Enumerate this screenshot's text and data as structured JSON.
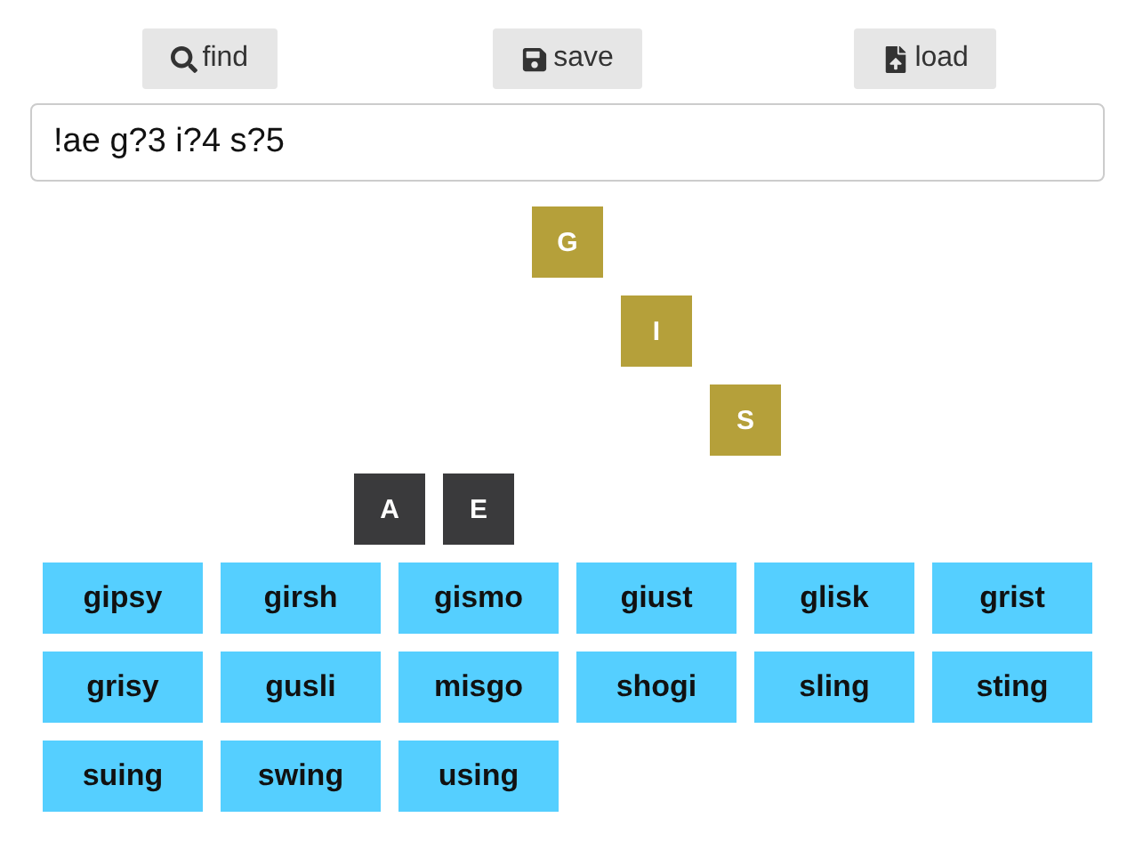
{
  "toolbar": [
    {
      "kind": "find",
      "label": "find"
    },
    {
      "kind": "save",
      "label": "save"
    },
    {
      "kind": "load",
      "label": "load"
    }
  ],
  "query": {
    "value": "!ae g?3 i?4 s?5"
  },
  "board": [
    [
      {
        "kind": "blank"
      },
      {
        "kind": "blank"
      },
      {
        "kind": "tile",
        "letter": "G",
        "color": "#b5a03a"
      }
    ],
    [
      {
        "kind": "blank"
      },
      {
        "kind": "blank"
      },
      {
        "kind": "blank"
      },
      {
        "kind": "tile",
        "letter": "I",
        "color": "#b5a03a"
      }
    ],
    [
      {
        "kind": "blank"
      },
      {
        "kind": "blank"
      },
      {
        "kind": "blank"
      },
      {
        "kind": "blank"
      },
      {
        "kind": "tile",
        "letter": "S",
        "color": "#b5a03a"
      }
    ],
    [
      {
        "kind": "tile",
        "letter": "A",
        "color": "#3a3a3c"
      },
      {
        "kind": "tile",
        "letter": "E",
        "color": "#3a3a3c"
      }
    ]
  ],
  "words": [
    "gipsy",
    "girsh",
    "gismo",
    "giust",
    "glisk",
    "grist",
    "grisy",
    "gusli",
    "misgo",
    "shogi",
    "sling",
    "sting",
    "suing",
    "swing",
    "using"
  ]
}
